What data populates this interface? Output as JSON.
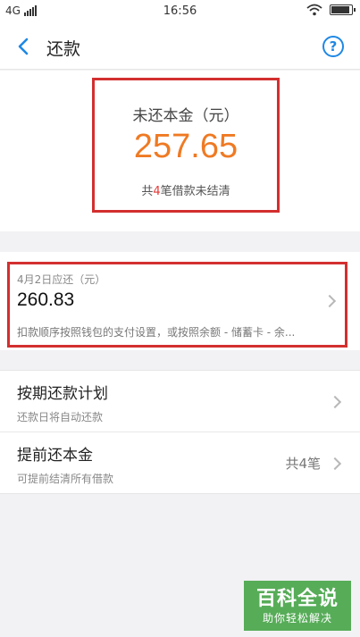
{
  "status_bar": {
    "network": "4G",
    "time": "16:56"
  },
  "nav": {
    "title": "还款",
    "help_icon": "?"
  },
  "summary": {
    "label": "未还本金（元）",
    "amount": "257.65",
    "loans_prefix": "共",
    "loans_count": "4",
    "loans_suffix": "笔借款未结清"
  },
  "due": {
    "label": "4月2日应还（元）",
    "amount": "260.83",
    "note": "扣款顺序按照钱包的支付设置，或按照余额 - 储蓄卡 - 余..."
  },
  "menu": {
    "items": [
      {
        "title": "按期还款计划",
        "subtitle": "还款日将自动还款",
        "count": ""
      },
      {
        "title": "提前还本金",
        "subtitle": "可提前结清所有借款",
        "count": "共4笔"
      }
    ]
  },
  "watermark": {
    "title": "百科全说",
    "subtitle": "助你轻松解决"
  },
  "colors": {
    "accent_blue": "#1e88e5",
    "amount_orange": "#ef7a23",
    "highlight_red": "#e53935",
    "annotation_border": "#d32f2f"
  }
}
